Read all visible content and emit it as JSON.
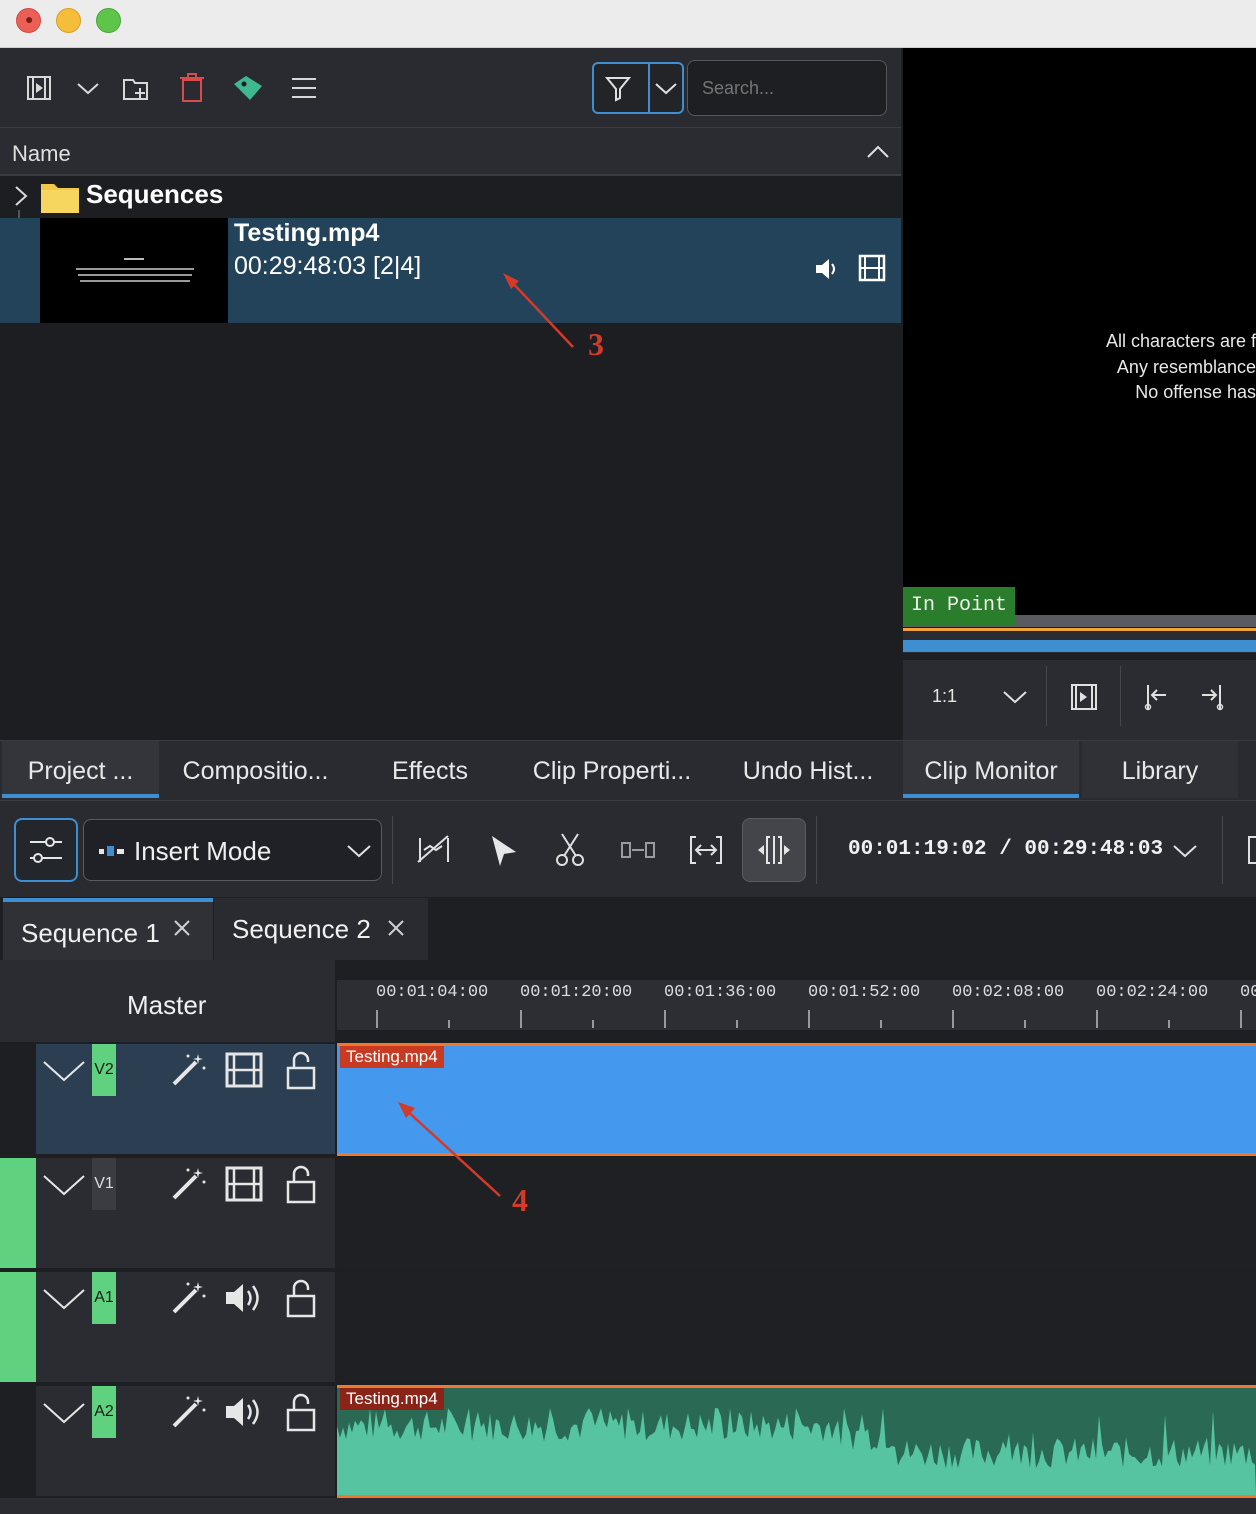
{
  "bin": {
    "search_placeholder": "Search...",
    "column_name": "Name",
    "folder": "Sequences",
    "clip": {
      "name": "Testing.mp4",
      "duration": "00:29:48:03 [2|4]"
    }
  },
  "monitor": {
    "lines": [
      "All characters are f",
      "Any resemblance",
      "No offense has"
    ],
    "in_point": "In Point",
    "zoom": "1:1"
  },
  "tabs": [
    "Project ...",
    "Compositio...",
    "Effects",
    "Clip Properti...",
    "Undo Hist...",
    "Clip Monitor",
    "Library"
  ],
  "timeline_toolbar": {
    "mode": "Insert Mode",
    "timecode": "00:01:19:02 / 00:29:48:03"
  },
  "sequences": [
    {
      "label": "Sequence 1"
    },
    {
      "label": "Sequence 2"
    }
  ],
  "timeline": {
    "master": "Master",
    "ruler": [
      "00:01:04:00",
      "00:01:20:00",
      "00:01:36:00",
      "00:01:52:00",
      "00:02:08:00",
      "00:02:24:00",
      "00"
    ],
    "tracks": [
      {
        "id": "V2",
        "clip": "Testing.mp4"
      },
      {
        "id": "V1",
        "clip": ""
      },
      {
        "id": "A1",
        "clip": ""
      },
      {
        "id": "A2",
        "clip": "Testing.mp4"
      }
    ]
  },
  "annotations": [
    "3",
    "4"
  ],
  "colors": {
    "accent": "#3d8fd1",
    "video_clip": "#4499ee",
    "audio_clip": "#56c4a0",
    "track_active": "#5fd17f",
    "clip_label": "#c93a22",
    "annotation": "#d23a2a"
  }
}
